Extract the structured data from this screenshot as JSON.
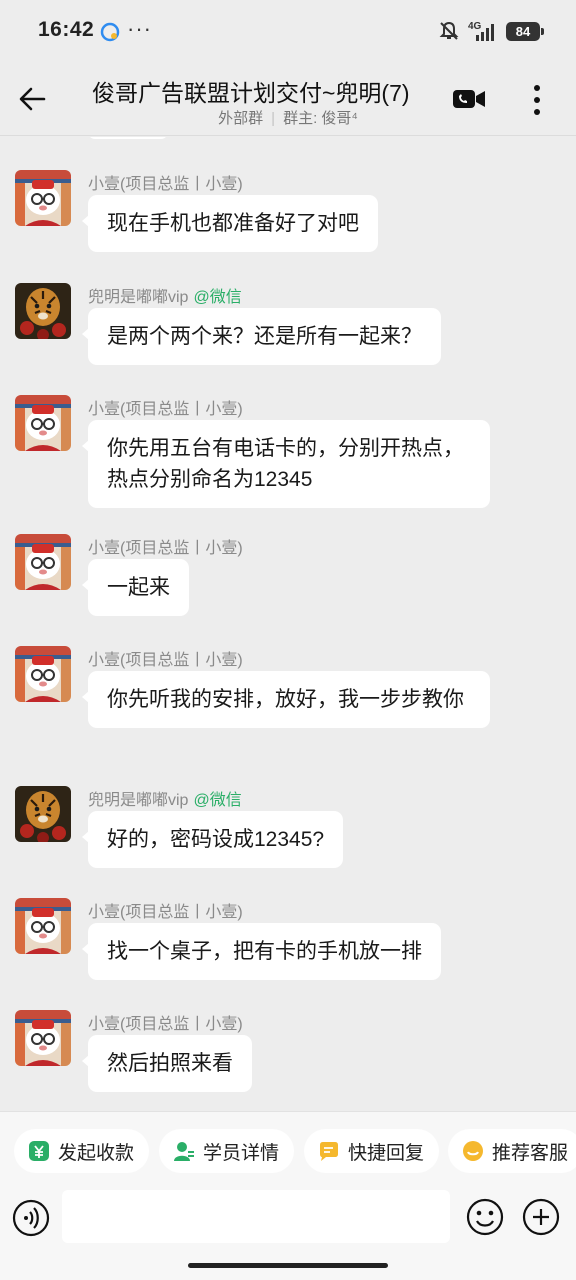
{
  "status": {
    "time": "16:42",
    "dots": "···",
    "network": "4G",
    "battery": "84"
  },
  "header": {
    "title": "俊哥广告联盟计划交付~兜明(7)",
    "subtitle_left": "外部群",
    "subtitle_sep": "|",
    "subtitle_right": "群主: 俊哥⁴"
  },
  "messages": [
    {
      "sender": "小壹(项目总监丨小壹)",
      "tag": "",
      "text": "现在手机也都准备好了对吧",
      "avatar": "avatar-xiaoyi"
    },
    {
      "sender": "兜明是嘟嘟vip",
      "tag": "@微信",
      "text": "是两个两个来？还是所有一起来？",
      "avatar": "avatar-tiger"
    },
    {
      "sender": "小壹(项目总监丨小壹)",
      "tag": "",
      "text": "你先用五台有电话卡的，分别开热点，热点分别命名为12345",
      "avatar": "avatar-xiaoyi"
    },
    {
      "sender": "小壹(项目总监丨小壹)",
      "tag": "",
      "text": "一起来",
      "avatar": "avatar-xiaoyi"
    },
    {
      "sender": "小壹(项目总监丨小壹)",
      "tag": "",
      "text": "你先听我的安排，放好，我一步步教你",
      "avatar": "avatar-xiaoyi"
    },
    {
      "sender": "兜明是嘟嘟vip",
      "tag": "@微信",
      "text": "好的，密码设成12345?",
      "avatar": "avatar-tiger"
    },
    {
      "sender": "小壹(项目总监丨小壹)",
      "tag": "",
      "text": "找一个桌子，把有卡的手机放一排",
      "avatar": "avatar-xiaoyi"
    },
    {
      "sender": "小壹(项目总监丨小壹)",
      "tag": "",
      "text": "然后拍照来看",
      "avatar": "avatar-xiaoyi"
    }
  ],
  "quick_actions": [
    {
      "label": "发起收款",
      "icon": "payment-icon",
      "color": "#2aae67"
    },
    {
      "label": "学员详情",
      "icon": "student-icon",
      "color": "#2aae67"
    },
    {
      "label": "快捷回复",
      "icon": "quick-reply-icon",
      "color": "#f5b82e"
    },
    {
      "label": "推荐客服",
      "icon": "recommend-icon",
      "color": "#f5b82e"
    }
  ],
  "input": {
    "value": "",
    "placeholder": ""
  },
  "colors": {
    "accent_green": "#2aae67",
    "bubble": "#ffffff",
    "background": "#ededed"
  }
}
